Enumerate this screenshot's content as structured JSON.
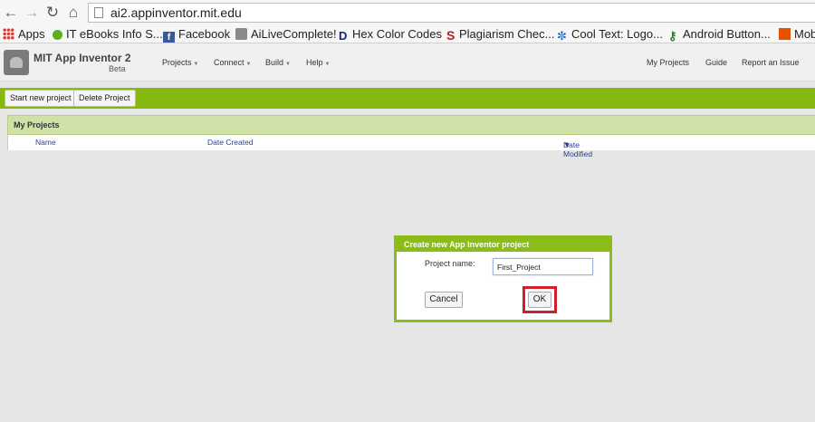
{
  "browser": {
    "url": "ai2.appinventor.mit.edu",
    "bookmarks": [
      {
        "label": "Apps",
        "icon": "apps-grid-icon",
        "color": "#d23f31"
      },
      {
        "label": "IT eBooks Info S...",
        "icon": "green-dot-icon",
        "color": "#5cae20"
      },
      {
        "label": "Facebook",
        "icon": "facebook-icon",
        "color": "#3b5998"
      },
      {
        "label": "AiLiveComplete!",
        "icon": "android-icon",
        "color": "#777777"
      },
      {
        "label": "Hex Color Codes",
        "icon": "d-logo-icon",
        "color": "#1a237e"
      },
      {
        "label": "Plagiarism Chec...",
        "icon": "s-logo-icon",
        "color": "#b71c1c"
      },
      {
        "label": "Cool Text: Logo...",
        "icon": "swirl-icon",
        "color": "#1565c0"
      },
      {
        "label": "Android Button...",
        "icon": "android-green-icon",
        "color": "#2e7d32"
      },
      {
        "label": "Mob",
        "icon": "orange-square-icon",
        "color": "#e65100"
      }
    ]
  },
  "app": {
    "title": "MIT App Inventor 2",
    "beta": "Beta",
    "menus": [
      "Projects",
      "Connect",
      "Build",
      "Help"
    ],
    "right_links": [
      "My Projects",
      "Guide",
      "Report an Issue"
    ],
    "accent": "#87b80f"
  },
  "toolbar": {
    "start_new": "Start new project",
    "delete": "Delete Project"
  },
  "projects": {
    "title": "My Projects",
    "columns": [
      "Name",
      "Date Created",
      "Date Modified"
    ],
    "sort_indicator": "▼"
  },
  "dialog": {
    "title": "Create new App Inventor project",
    "label": "Project name:",
    "value": "First_Project",
    "cancel": "Cancel",
    "ok": "OK",
    "highlight_color": "#d21f2a"
  }
}
